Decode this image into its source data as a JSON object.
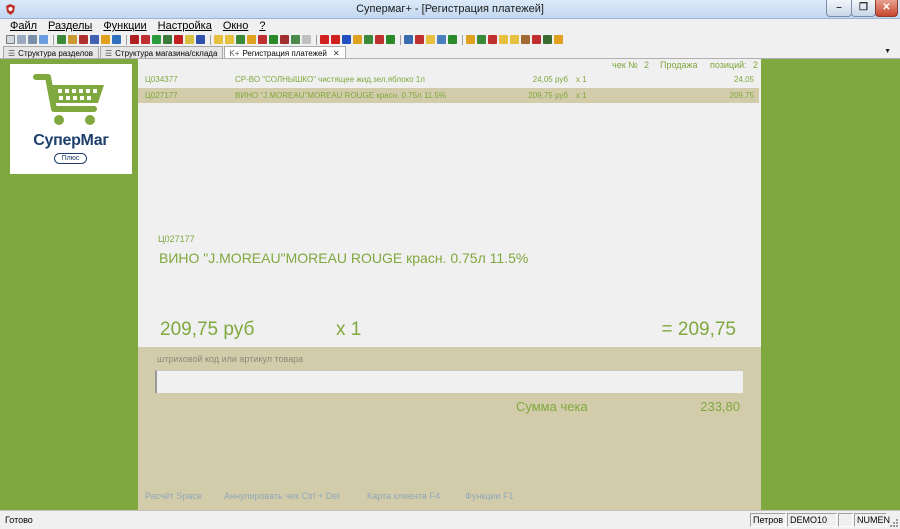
{
  "window": {
    "title": "Супермаг+  - [Регистрация платежей]"
  },
  "menu": [
    "Файл",
    "Разделы",
    "Функции",
    "Настройка",
    "Окно",
    "?"
  ],
  "tabs": [
    {
      "label": "Структура разделов",
      "icon": "tree-icon",
      "active": false
    },
    {
      "label": "Структура магазина/склада",
      "icon": "tree-icon",
      "active": false
    },
    {
      "label": "Регистрация платежей",
      "icon": "cashbox-icon",
      "active": true
    }
  ],
  "logo": {
    "name": "СуперМаг",
    "badge": "Плюс"
  },
  "receipt": {
    "check_label": "чек №",
    "check_number": "2",
    "mode": "Продажа",
    "positions_label": "позиций:",
    "positions_count": "2",
    "rows": [
      {
        "code": "Ц034377",
        "name": "СР-ВО \"СОЛНЫШКО\" чистящее жид.зел.яблоко 1л",
        "price": "24,05 руб",
        "qty": "x 1",
        "sum": "24,05",
        "selected": false
      },
      {
        "code": "Ц027177",
        "name": "ВИНО \"J.MOREAU\"MOREAU ROUGE красн. 0.75л 11.5%",
        "price": "209,75 руб",
        "qty": "x 1",
        "sum": "209,75",
        "selected": true
      }
    ]
  },
  "current_item": {
    "code": "Ц027177",
    "name": "ВИНО \"J.MOREAU\"MOREAU ROUGE красн. 0.75л 11.5%",
    "price": "209,75 руб",
    "qty": "x 1",
    "total": "= 209,75"
  },
  "input": {
    "label": "штриховой код или артикул товара",
    "value": "",
    "placeholder": ""
  },
  "summary": {
    "label": "Сумма чека",
    "value": "233,80"
  },
  "hotkeys": [
    "Расчёт Space",
    "Аннулировать чек Ctrl + Del",
    "Карта клиента F4",
    "Функции F1"
  ],
  "status": {
    "text": "Готово",
    "user": "Петров",
    "db": "DEMO10",
    "num": "NUMЕN"
  },
  "colors": {
    "accent": "#7fa83e",
    "panel": "#d3ccaa",
    "logo_text": "#1e3f6b"
  }
}
